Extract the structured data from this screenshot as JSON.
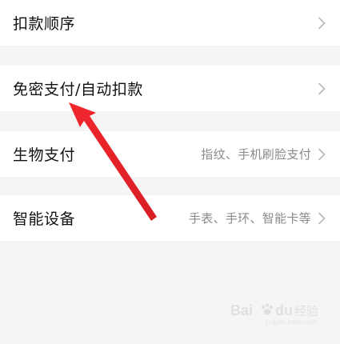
{
  "settings": {
    "items": [
      {
        "label": "扣款顺序",
        "detail": ""
      },
      {
        "label": "免密支付/自动扣款",
        "detail": ""
      },
      {
        "label": "生物支付",
        "detail": "指纹、手机刷脸支付"
      },
      {
        "label": "智能设备",
        "detail": "手表、手环、智能卡等"
      }
    ]
  },
  "icons": {
    "chevron": "chevron-right-icon",
    "annotation": "red-arrow"
  },
  "colors": {
    "background": "#f5f5f5",
    "card": "#ffffff",
    "label": "#111111",
    "detail": "#8a8a8a",
    "chevron": "#b8b8b8",
    "annotation_arrow": "#e8262c"
  },
  "watermark": {
    "brand": "Bai du",
    "suffix": "经验",
    "url": "jingyan.baidu.com"
  }
}
